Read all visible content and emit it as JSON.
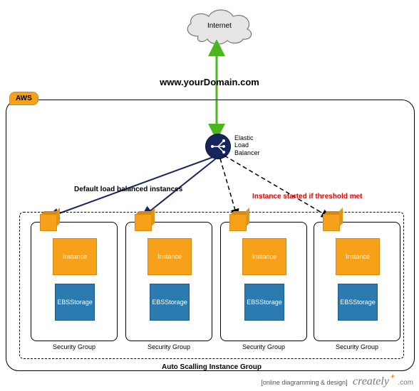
{
  "brand_tag_text": "[online diagramming & design]",
  "brand_logo_text": "creately",
  "brand_suffix": ".com",
  "cloud": {
    "label": "Internet"
  },
  "domain_label": "www.yourDomain.com",
  "aws_badge": "AWS",
  "elb": {
    "line1": "Elastic",
    "line2": "Load",
    "line3": "Balancer"
  },
  "notes": {
    "default_balanced": "Default load balanced instances",
    "threshold": "Instance started if threshold met"
  },
  "asg_label": "Auto Scalling Instance Group",
  "sg_label": "Security Group",
  "instance_label": "Instance",
  "ebs_line1": "EBS",
  "ebs_line2": "Storage",
  "colors": {
    "orange": "#f7a11a",
    "blue": "#2b7ab0",
    "navy": "#17255f",
    "green": "#4cb61e",
    "red": "#e20000"
  }
}
